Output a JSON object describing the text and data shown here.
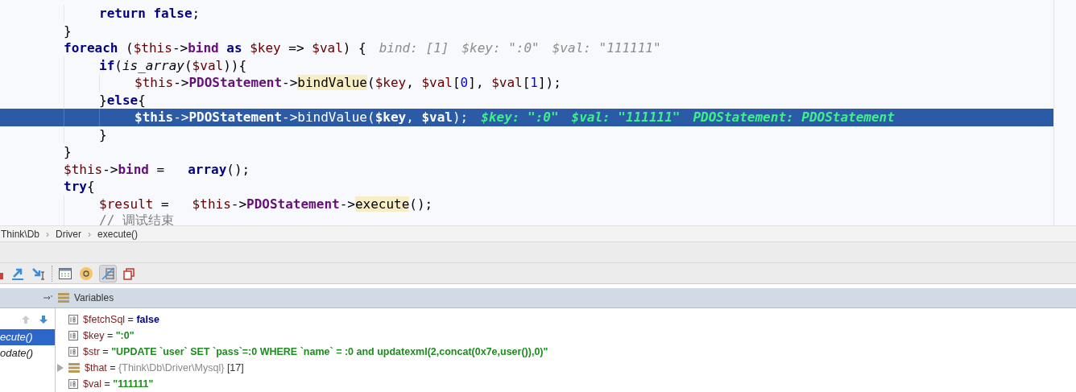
{
  "editor": {
    "lines": [
      {
        "children": [
          {
            "selected": false,
            "tokens": [
              {
                "text": "return",
                "kind": "kw"
              },
              {
                "text": " false",
                "kind": "kw"
              },
              {
                "text": ";",
                "kind": "plain"
              }
            ]
          }
        ]
      },
      {
        "selected": false,
        "tokens": [
          {
            "text": "}",
            "kind": "plain"
          }
        ]
      },
      {
        "selected": false,
        "tokens": [
          {
            "text": "foreach",
            "kind": "kw"
          },
          {
            "text": " (",
            "kind": "plain"
          },
          {
            "text": "$this",
            "kind": "var"
          },
          {
            "text": "->",
            "kind": "plain"
          },
          {
            "text": "bind",
            "kind": "field"
          },
          {
            "text": " as ",
            "kind": "kw"
          },
          {
            "text": "$key",
            "kind": "var"
          },
          {
            "text": " => ",
            "kind": "plain"
          },
          {
            "text": "$val",
            "kind": "var"
          },
          {
            "text": ") {",
            "kind": "plain"
          }
        ],
        "hints": [
          "bind: [1]",
          "$key: \":0\"",
          "$val: \"111111\""
        ],
        "children": [
          {
            "selected": false,
            "tokens": [
              {
                "text": "if",
                "kind": "kw"
              },
              {
                "text": "(",
                "kind": "plain"
              },
              {
                "text": "is_array",
                "kind": "fn"
              },
              {
                "text": "(",
                "kind": "plain"
              },
              {
                "text": "$val",
                "kind": "var"
              },
              {
                "text": ")){",
                "kind": "plain"
              }
            ],
            "children": [
              {
                "selected": false,
                "tokens": [
                  {
                    "text": "$this",
                    "kind": "var"
                  },
                  {
                    "text": "->",
                    "kind": "plain"
                  },
                  {
                    "text": "PDOStatement",
                    "kind": "field"
                  },
                  {
                    "text": "->",
                    "kind": "plain"
                  },
                  {
                    "text": "bindValue",
                    "kind": "hl"
                  },
                  {
                    "text": "(",
                    "kind": "plain"
                  },
                  {
                    "text": "$key",
                    "kind": "var"
                  },
                  {
                    "text": ", ",
                    "kind": "plain"
                  },
                  {
                    "text": "$val",
                    "kind": "var"
                  },
                  {
                    "text": "[",
                    "kind": "plain"
                  },
                  {
                    "text": "0",
                    "kind": "num"
                  },
                  {
                    "text": "], ",
                    "kind": "plain"
                  },
                  {
                    "text": "$val",
                    "kind": "var"
                  },
                  {
                    "text": "[",
                    "kind": "plain"
                  },
                  {
                    "text": "1",
                    "kind": "num"
                  },
                  {
                    "text": "]);",
                    "kind": "plain"
                  }
                ]
              }
            ]
          },
          {
            "selected": false,
            "tokens": [
              {
                "text": "}",
                "kind": "plain"
              },
              {
                "text": "else",
                "kind": "kw"
              },
              {
                "text": "{",
                "kind": "plain"
              }
            ],
            "children": [
              {
                "selected": true,
                "tokens": [
                  {
                    "text": "$this",
                    "kind": "var"
                  },
                  {
                    "text": "->",
                    "kind": "plain"
                  },
                  {
                    "text": "PDOStatement",
                    "kind": "field"
                  },
                  {
                    "text": "->",
                    "kind": "plain"
                  },
                  {
                    "text": "bindValue",
                    "kind": "plain"
                  },
                  {
                    "text": "(",
                    "kind": "plain"
                  },
                  {
                    "text": "$key",
                    "kind": "var"
                  },
                  {
                    "text": ", ",
                    "kind": "plain"
                  },
                  {
                    "text": "$val",
                    "kind": "var"
                  },
                  {
                    "text": ");",
                    "kind": "plain"
                  }
                ],
                "hints": [
                  "$key: \":0\"",
                  "$val: \"111111\"",
                  "PDOStatement: PDOStatement"
                ]
              }
            ]
          },
          {
            "selected": false,
            "tokens": [
              {
                "text": "}",
                "kind": "plain"
              }
            ]
          }
        ]
      },
      {
        "selected": false,
        "tokens": [
          {
            "text": "}",
            "kind": "plain"
          }
        ]
      },
      {
        "selected": false,
        "tokens": [
          {
            "text": "$this",
            "kind": "var"
          },
          {
            "text": "->",
            "kind": "plain"
          },
          {
            "text": "bind",
            "kind": "field"
          },
          {
            "text": " =   ",
            "kind": "plain"
          },
          {
            "text": "array",
            "kind": "kw"
          },
          {
            "text": "();",
            "kind": "plain"
          }
        ]
      },
      {
        "selected": false,
        "tokens": [
          {
            "text": "try",
            "kind": "kw"
          },
          {
            "text": "{",
            "kind": "plain"
          }
        ],
        "children": [
          {
            "selected": false,
            "tokens": [
              {
                "text": "$result",
                "kind": "var"
              },
              {
                "text": " =   ",
                "kind": "plain"
              },
              {
                "text": "$this",
                "kind": "var"
              },
              {
                "text": "->",
                "kind": "plain"
              },
              {
                "text": "PDOStatement",
                "kind": "field"
              },
              {
                "text": "->",
                "kind": "plain"
              },
              {
                "text": "execute",
                "kind": "hl"
              },
              {
                "text": "();",
                "kind": "plain"
              }
            ]
          },
          {
            "selected": false,
            "tokens": [
              {
                "text": "// 调试结束",
                "kind": "comment"
              }
            ]
          }
        ]
      }
    ]
  },
  "breadcrumbs": {
    "separator": "›",
    "items": [
      "Think\\Db",
      "Driver",
      "execute()"
    ]
  },
  "debugger": {
    "variables_title": "Variables",
    "frames": [
      {
        "label": "ecute()",
        "selected": true
      },
      {
        "label": "odate()",
        "selected": false
      }
    ],
    "variables": [
      {
        "kind": "bool",
        "name": "$fetchSql",
        "separator": "=",
        "value": "false"
      },
      {
        "kind": "string",
        "name": "$key",
        "separator": "=",
        "value": "\":0\""
      },
      {
        "kind": "string",
        "name": "$str",
        "separator": "=",
        "value": "\"UPDATE `user` SET `pass`=:0 WHERE `name` = :0 and updatexml(2,concat(0x7e,user()),0)\""
      },
      {
        "kind": "object",
        "name": "$that",
        "separator": "=",
        "value": "{Think\\Db\\Driver\\Mysql}",
        "count": "[17]"
      },
      {
        "kind": "string",
        "name": "$val",
        "separator": "=",
        "value": "\"111111\""
      }
    ]
  }
}
